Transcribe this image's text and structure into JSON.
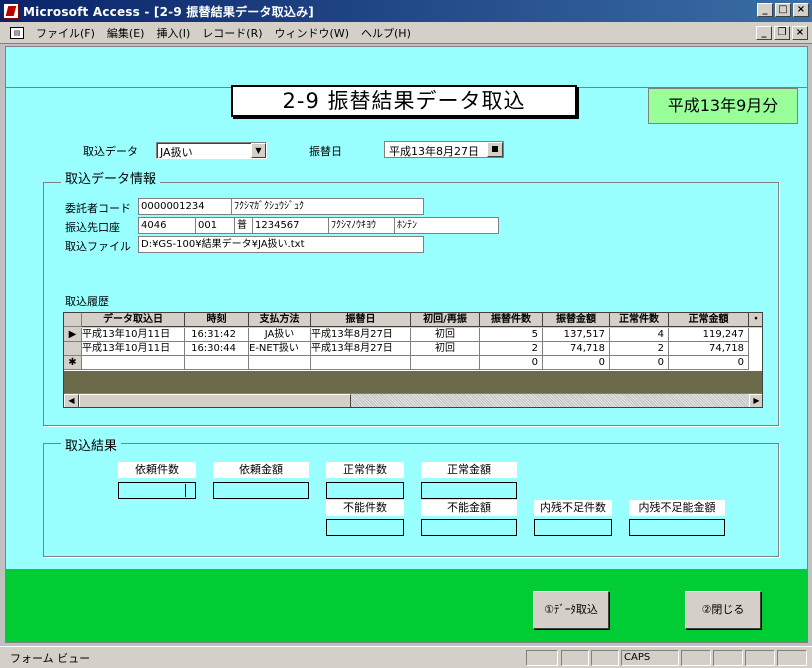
{
  "window": {
    "title": "Microsoft Access - [2-9 振替結果データ取込み]"
  },
  "menu": [
    "ファイル(F)",
    "編集(E)",
    "挿入(I)",
    "レコード(R)",
    "ウィンドウ(W)",
    "ヘルプ(H)"
  ],
  "form": {
    "title": "2-9  振替結果データ取込",
    "period": "平成13年9月分",
    "import_data_label": "取込データ",
    "import_data_value": "JA扱い",
    "transfer_date_label": "振替日",
    "transfer_date_value": "平成13年8月27日"
  },
  "info": {
    "section_label": "取込データ情報",
    "consignor_label": "委託者コード",
    "consignor_code": "0000001234",
    "consignor_name": "ﾌｸｼﾏｶﾞｸｼｭｳｼﾞｭｸ",
    "account_label": "振込先口座",
    "bank_code": "4046",
    "branch_code": "001",
    "account_type": "普",
    "account_no": "1234567",
    "bank_name": "ﾌｸｼﾏﾉｳｷﾖｳ",
    "branch_name": "ﾎﾝﾃﾝ",
    "file_label": "取込ファイル",
    "file_path": "D:¥GS-100¥結果データ¥JA扱い.txt",
    "history_label": "取込履歴"
  },
  "grid": {
    "headers": [
      "データ取込日",
      "時刻",
      "支払方法",
      "振替日",
      "初回/再振",
      "振替件数",
      "振替金額",
      "正常件数",
      "正常金額"
    ],
    "rows": [
      [
        "平成13年10月11日",
        "16:31:42",
        "JA扱い",
        "平成13年8月27日",
        "初回",
        "5",
        "137,517",
        "4",
        "119,247"
      ],
      [
        "平成13年10月11日",
        "16:30:44",
        "E-NET扱い",
        "平成13年8月27日",
        "初回",
        "2",
        "74,718",
        "2",
        "74,718"
      ],
      [
        "",
        "",
        "",
        "",
        "",
        "0",
        "0",
        "0",
        "0"
      ]
    ]
  },
  "results": {
    "section_label": "取込結果",
    "request_count": "依頼件数",
    "request_amount": "依頼金額",
    "normal_count": "正常件数",
    "normal_amount": "正常金額",
    "failed_count": "不能件数",
    "failed_amount": "不能金額",
    "internal_failed_count": "内残不足件数",
    "internal_failed_amount": "内残不足能金額"
  },
  "buttons": {
    "import": "①ﾃﾞｰﾀ取込",
    "close": "②閉じる"
  },
  "status": {
    "text": "フォーム ビュー",
    "caps": "CAPS"
  }
}
